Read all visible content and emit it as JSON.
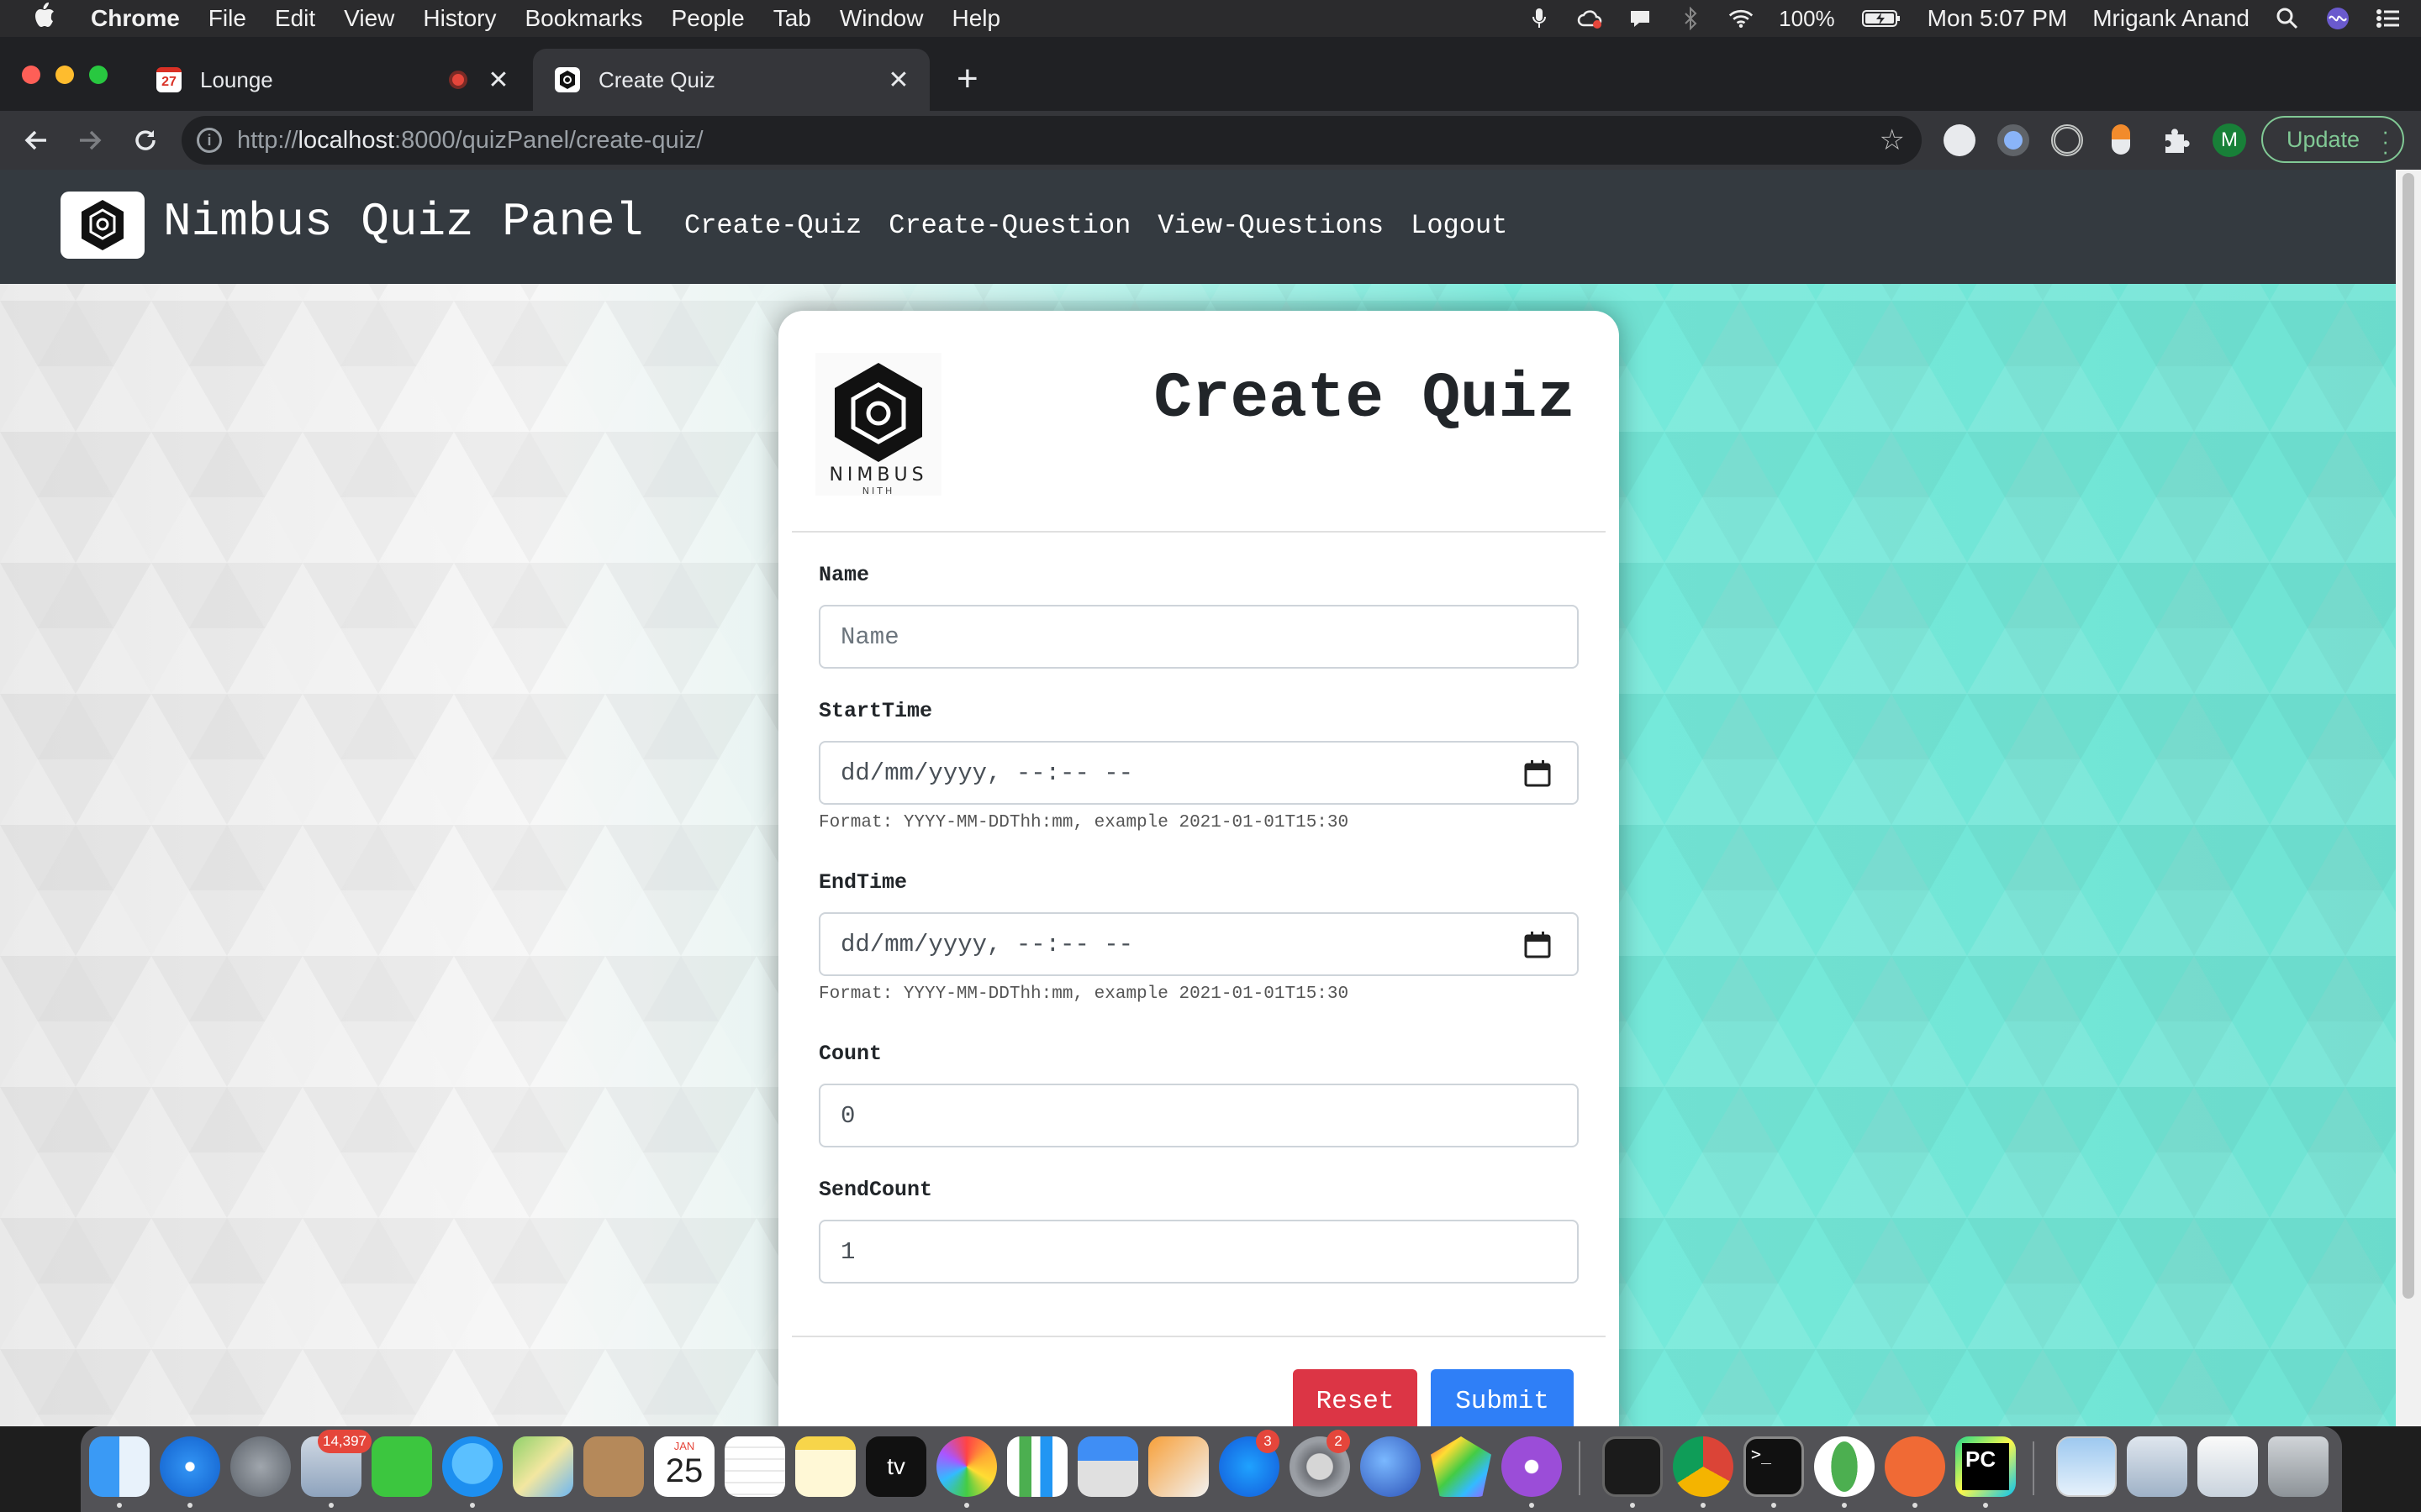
{
  "menubar": {
    "app_name": "Chrome",
    "items": [
      "File",
      "Edit",
      "View",
      "History",
      "Bookmarks",
      "People",
      "Tab",
      "Window",
      "Help"
    ],
    "battery": "100%",
    "clock": "Mon 5:07 PM",
    "user": "Mrigank Anand"
  },
  "browser": {
    "tabs": [
      {
        "title": "Lounge",
        "favicon_text": "27"
      },
      {
        "title": "Create Quiz"
      }
    ],
    "url_prefix": "http://",
    "url_host": "localhost",
    "url_rest": ":8000/quizPanel/create-quiz/",
    "avatar_initial": "M",
    "update_label": "Update"
  },
  "page": {
    "brand": "Nimbus Quiz Panel",
    "nav": [
      "Create-Quiz",
      "Create-Question",
      "View-Questions",
      "Logout"
    ],
    "logo_text": "NIMBUS",
    "logo_subtext": "NITH",
    "form_title": "Create Quiz",
    "fields": {
      "name": {
        "label": "Name",
        "placeholder": "Name"
      },
      "start": {
        "label": "StartTime",
        "value": "dd/mm/yyyy, --:-- --",
        "help": "Format: YYYY-MM-DDThh:mm, example 2021-01-01T15:30"
      },
      "end": {
        "label": "EndTime",
        "value": "dd/mm/yyyy, --:-- --",
        "help": "Format: YYYY-MM-DDThh:mm, example 2021-01-01T15:30"
      },
      "count": {
        "label": "Count",
        "value": "0"
      },
      "sendcount": {
        "label": "SendCount",
        "value": "1"
      }
    },
    "buttons": {
      "reset": "Reset",
      "submit": "Submit"
    }
  },
  "dock": {
    "badges": {
      "mail": "14,397",
      "appstore": "3",
      "settings": "2"
    },
    "calendar_month": "JAN",
    "calendar_day": "25",
    "tv_label": "tv",
    "pycharm_label": "PC"
  },
  "colors": {
    "navbar": "#343a40",
    "reset": "#dc3545",
    "submit": "#2f7ff7",
    "background_accent": "#5fe8d6"
  }
}
